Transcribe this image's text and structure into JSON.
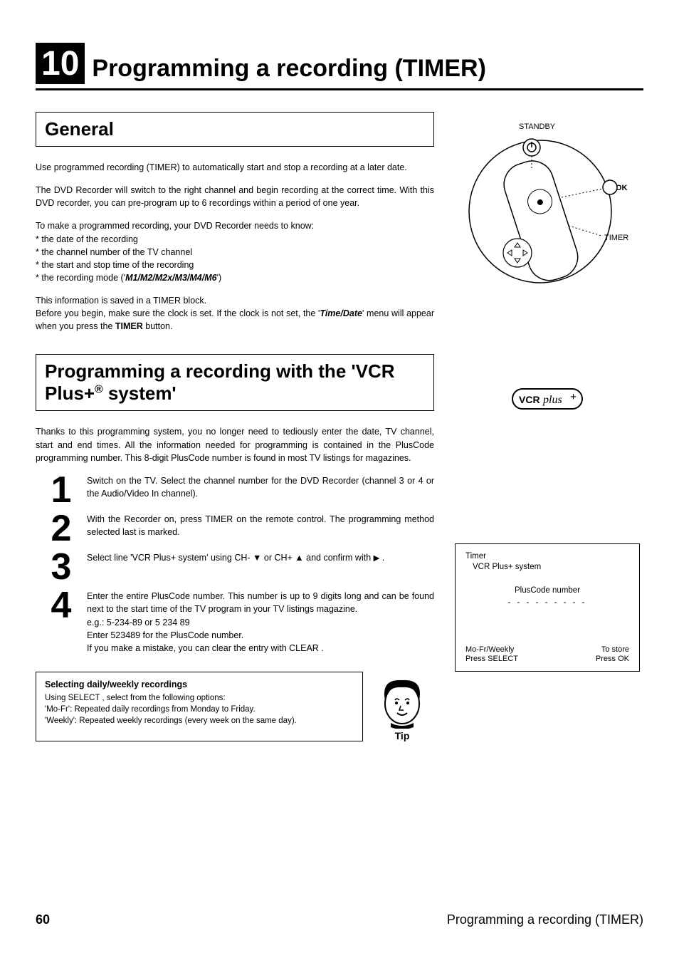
{
  "chapter": {
    "number": "10",
    "title": "Programming a recording (TIMER)"
  },
  "remote_labels": {
    "standby": "STANDBY",
    "ok": "OK",
    "timer": "TIMER"
  },
  "section_general": {
    "heading": "General",
    "p1": "Use programmed recording (TIMER) to automatically start and stop a recording at a later date.",
    "p2": "The DVD Recorder will switch to the right channel and begin recording at the correct time. With this DVD recorder, you can pre-program up to 6 recordings within a period of one year.",
    "intro_list_lead": "To make a programmed recording, your DVD Recorder needs to know:",
    "b1": "* the date of the recording",
    "b2": "* the channel number of the TV channel",
    "b3": "* the start and stop time of the recording",
    "b4_prefix": "* the recording mode ('",
    "b4_modes": "M1/M2/M2x/M3/M4/M6",
    "b4_suffix": "')",
    "p3a": "This information is saved in a TIMER block.",
    "p3b_prefix": "Before you begin, make sure the clock is set. If the clock is not set, the '",
    "p3b_menu": "Time/Date",
    "p3b_mid": "' menu will appear when you press the ",
    "p3b_button": "TIMER",
    "p3b_suffix": " button."
  },
  "section_vcrplus": {
    "heading_line1": "Programming a recording with the 'VCR",
    "heading_line2_a": "Plus+",
    "heading_line2_b": " system'",
    "intro": "Thanks to this programming system, you no longer need to tediously enter the date, TV channel, start and end times. All the information needed for programming is contained in the PlusCode programming number. This 8-digit PlusCode number is found in most TV listings for magazines.",
    "step1": "Switch on the TV. Select the channel number for the DVD Recorder (channel 3 or 4 or the Audio/Video In channel).",
    "step2_prefix": "With the Recorder on, press ",
    "step2_button": "TIMER",
    "step2_suffix": " on the remote control. The programming method selected last is marked.",
    "step3_prefix": "Select line '",
    "step3_item": "VCR Plus+ system",
    "step3_mid1": "' using ",
    "step3_btn_down": "CH-",
    "step3_or": " or ",
    "step3_btn_up": "CH+",
    "step3_mid2": " and confirm with ",
    "step3_end": " .",
    "step4_p1": "Enter the entire PlusCode number. This number is up to 9 digits long and can be found next to the start time of the TV program in your TV listings magazine.",
    "step4_eg": "e.g.: 5-234-89 or 5 234 89",
    "step4_p2": "Enter 523489 for the PlusCode number.",
    "step4_p3_prefix": "If you make a mistake, you can clear the entry with ",
    "step4_p3_button": "CLEAR",
    "step4_p3_suffix": " ."
  },
  "tip": {
    "title": "Selecting daily/weekly recordings",
    "line1_prefix": "Using ",
    "line1_button": "SELECT",
    "line1_suffix": " , select from the following options:",
    "line2_label": "Mo-Fr",
    "line2_text": ": Repeated daily recordings from Monday to Friday.",
    "line3_label": "Weekly",
    "line3_text": ": Repeated weekly recordings (every week on the same day).",
    "badge": "Tip"
  },
  "vcrplus_logo_text": "VCRplus+",
  "onscreen": {
    "title": "Timer",
    "subtitle": "VCR Plus+ system",
    "field_label": "PlusCode number",
    "dashes": "- - - - - - - - -",
    "footer_left_1": "Mo-Fr/Weekly",
    "footer_left_2": "Press SELECT",
    "footer_right_1": "To store",
    "footer_right_2": "Press OK"
  },
  "footer": {
    "page": "60",
    "title": "Programming a recording (TIMER)"
  }
}
